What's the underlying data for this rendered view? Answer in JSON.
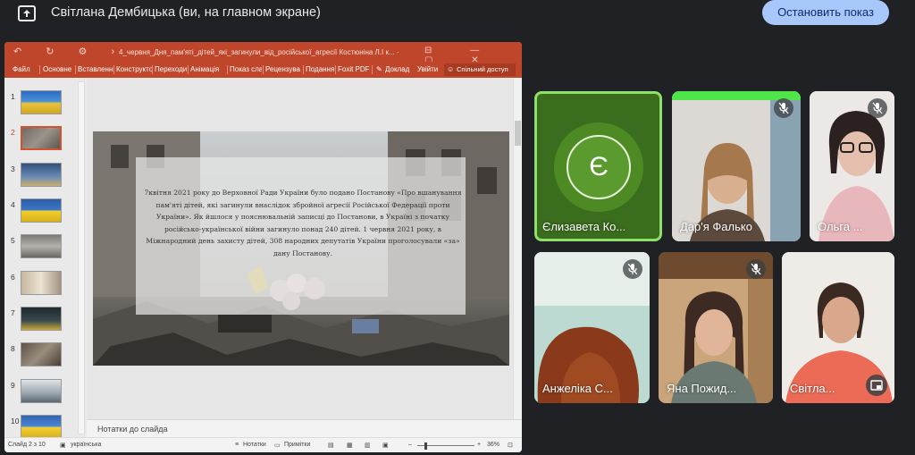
{
  "meet": {
    "presenter_title": "Світлана Дембицька (ви, на главном экране)",
    "stop_button": "Остановить показ",
    "icons": [
      "present-to-all-icon",
      "mic-off-icon",
      "picture-in-picture-icon"
    ]
  },
  "ppt": {
    "doc_title": "4_червня_Дня_пам'яті_дітей_які_загинули_від_російської_агресії Костюніна Л.І к... ·",
    "ribbon_tabs": [
      "Файл",
      "Основне",
      "Вставлення",
      "Конструктор",
      "Переходи",
      "Анімація",
      "Показ сла",
      "Рецензува",
      "Подання",
      "Foxit PDF",
      "Доклад",
      "Увійти"
    ],
    "share_button": "Спільний доступ",
    "slide_numbers": [
      "1",
      "2",
      "3",
      "4",
      "5",
      "6",
      "7",
      "8",
      "9",
      "10"
    ],
    "selected_slide": 2,
    "slide_text": "7квітня 2021 року до Верховної Ради України було подано Постанову «Про вшанування пам'яті дітей, які загинули внаслідок збройної агресії Російської Федерації проти України». Як йшлося у пояснювальній записці до Постанови, в Україні з початку російсько-української війни загинуло понад 240 дітей. 1 червня 2021 року, в Міжнародний день захисту дітей, 308 народних депутатів України проголосували «за» дану Постанову.",
    "notes_placeholder": "Нотатки до слайда",
    "status_slide": "Слайд 2 з 10",
    "status_lang": "українська",
    "status_notes": "Нотатки",
    "status_comments": "Примітки",
    "zoom": "36%"
  },
  "participants": [
    {
      "name": "Єлизавета Ко...",
      "initial": "Є",
      "speaking": true,
      "muted": false
    },
    {
      "name": "Дар'я Фалько",
      "muted": true
    },
    {
      "name": "Ольга ...",
      "muted": true
    },
    {
      "name": "Анжеліка С...",
      "muted": true
    },
    {
      "name": "Яна Пожид...",
      "muted": true
    },
    {
      "name": "Світла...",
      "muted": false
    }
  ],
  "colors": {
    "accent": "#a8c7fa",
    "ppt_brand": "#c0462b",
    "avatar_green": "#5b9a2e",
    "speaking_border": "#8ee06b"
  }
}
